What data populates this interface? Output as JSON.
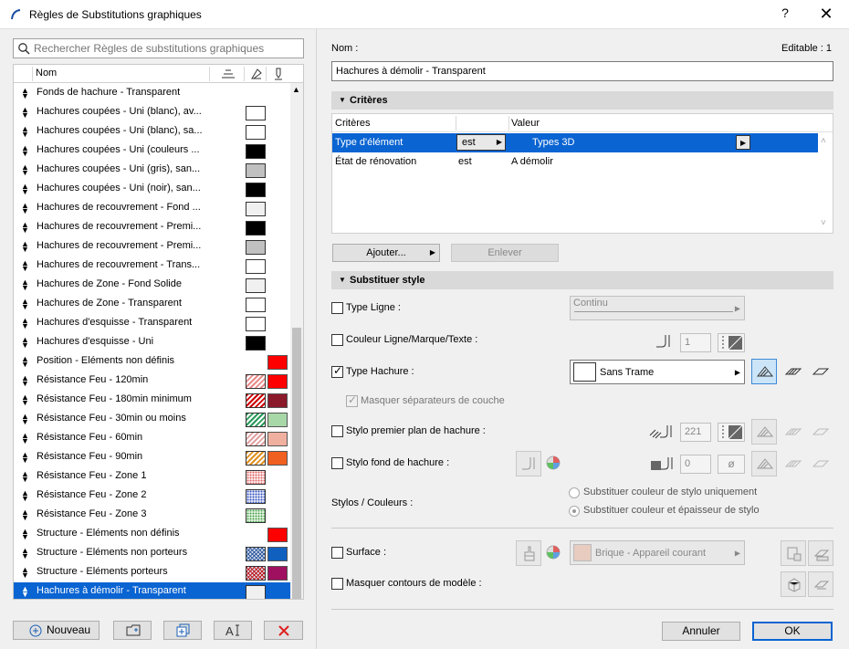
{
  "window": {
    "title": "Règles de Substitutions graphiques",
    "help": "?",
    "close": "✕"
  },
  "search": {
    "placeholder": "Rechercher Règles de substitutions graphiques"
  },
  "list": {
    "header": {
      "name": "Nom"
    },
    "rows": [
      {
        "label": "Fonds de hachure  - Transparent",
        "sw1": "",
        "sw2": ""
      },
      {
        "label": "Hachures coupées - Uni (blanc), av...",
        "sw1": "#ffffff",
        "sw2": ""
      },
      {
        "label": "Hachures coupées - Uni (blanc), sa...",
        "sw1": "#ffffff",
        "sw2": ""
      },
      {
        "label": "Hachures coupées - Uni (couleurs ...",
        "sw1": "#000000",
        "sw2": ""
      },
      {
        "label": "Hachures coupées - Uni (gris), san...",
        "sw1": "#c0c0c0",
        "sw2": ""
      },
      {
        "label": "Hachures coupées - Uni (noir), san...",
        "sw1": "#000000",
        "sw2": ""
      },
      {
        "label": "Hachures de recouvrement - Fond ...",
        "sw1": "#f0f0f0",
        "sw2": ""
      },
      {
        "label": "Hachures de recouvrement - Premi...",
        "sw1": "#000000",
        "sw2": ""
      },
      {
        "label": "Hachures de recouvrement - Premi...",
        "sw1": "#c0c0c0",
        "sw2": ""
      },
      {
        "label": "Hachures de recouvrement - Trans...",
        "sw1": "#ffffff",
        "sw2": ""
      },
      {
        "label": "Hachures de Zone - Fond Solide",
        "sw1": "#f0f0f0",
        "sw2": ""
      },
      {
        "label": "Hachures de Zone - Transparent",
        "sw1": "#ffffff",
        "sw2": ""
      },
      {
        "label": "Hachures d'esquisse - Transparent",
        "sw1": "#ffffff",
        "sw2": ""
      },
      {
        "label": "Hachures d'esquisse - Uni",
        "sw1": "#000000",
        "sw2": ""
      },
      {
        "label": "Position - Eléments non définis",
        "sw1": "",
        "sw2": "#ff0000"
      },
      {
        "label": "Résistance Feu - 120min",
        "sw1": "hatch:#e88a8a",
        "sw2": "#ff0000"
      },
      {
        "label": "Résistance Feu - 180min minimum",
        "sw1": "hatch:#cc0000",
        "sw2": "#8b1a2b"
      },
      {
        "label": "Résistance Feu - 30min ou moins",
        "sw1": "hatch:#2a9a5a",
        "sw2": "#a8d8a8"
      },
      {
        "label": "Résistance Feu - 60min",
        "sw1": "hatch:#e0a0a0",
        "sw2": "#f0b0a0"
      },
      {
        "label": "Résistance Feu - 90min",
        "sw1": "hatch:#e09020",
        "sw2": "#f06020"
      },
      {
        "label": "Résistance Feu - Zone 1",
        "sw1": "dots:#e06060",
        "sw2": ""
      },
      {
        "label": "Résistance Feu - Zone 2",
        "sw1": "dots:#3050c0",
        "sw2": ""
      },
      {
        "label": "Résistance Feu - Zone 3",
        "sw1": "dots:#40a040",
        "sw2": ""
      },
      {
        "label": "Structure - Eléments non définis",
        "sw1": "",
        "sw2": "#ff0000"
      },
      {
        "label": "Structure - Eléments non porteurs",
        "sw1": "cross:#3060a0",
        "sw2": "#1060c0"
      },
      {
        "label": "Structure - Eléments porteurs",
        "sw1": "cross:#c02020",
        "sw2": "#a01060"
      },
      {
        "label": "Hachures à démolir - Transparent",
        "sw1": "#f0f0f0",
        "sw2": "",
        "selected": true
      }
    ]
  },
  "left_buttons": {
    "new": "Nouveau"
  },
  "name_section": {
    "label": "Nom :",
    "editable": "Editable : 1",
    "value": "Hachures à démolir - Transparent"
  },
  "criteria_section": {
    "title": "Critères",
    "headers": [
      "Critères",
      "",
      "Valeur"
    ],
    "rows": [
      {
        "crit": "Type d'élément",
        "op": "est",
        "val": "Types 3D",
        "selected": true
      },
      {
        "crit": "État de rénovation",
        "op": "est",
        "val": "A démolir"
      }
    ],
    "add": "Ajouter...",
    "remove": "Enlever"
  },
  "style_section": {
    "title": "Substituer style",
    "line_type": {
      "label": "Type Ligne :",
      "value": "Continu"
    },
    "line_color": {
      "label": "Couleur Ligne/Marque/Texte :",
      "pen": "1"
    },
    "fill_type": {
      "label": "Type Hachure :",
      "value": "Sans Trame"
    },
    "hide_layers": "Masquer séparateurs de couche",
    "fg_pen": {
      "label": "Stylo premier plan de hachure :",
      "pen": "221"
    },
    "bg_pen": {
      "label": "Stylo fond de hachure :",
      "pen": "0"
    },
    "pens_colors": "Stylos / Couleurs :",
    "radio1": "Substituer couleur de stylo uniquement",
    "radio2": "Substituer couleur et épaisseur de stylo",
    "surface": {
      "label": "Surface :",
      "value": "Brique - Appareil courant"
    },
    "hide_model": "Masquer contours de modèle :"
  },
  "footer": {
    "cancel": "Annuler",
    "ok": "OK"
  }
}
